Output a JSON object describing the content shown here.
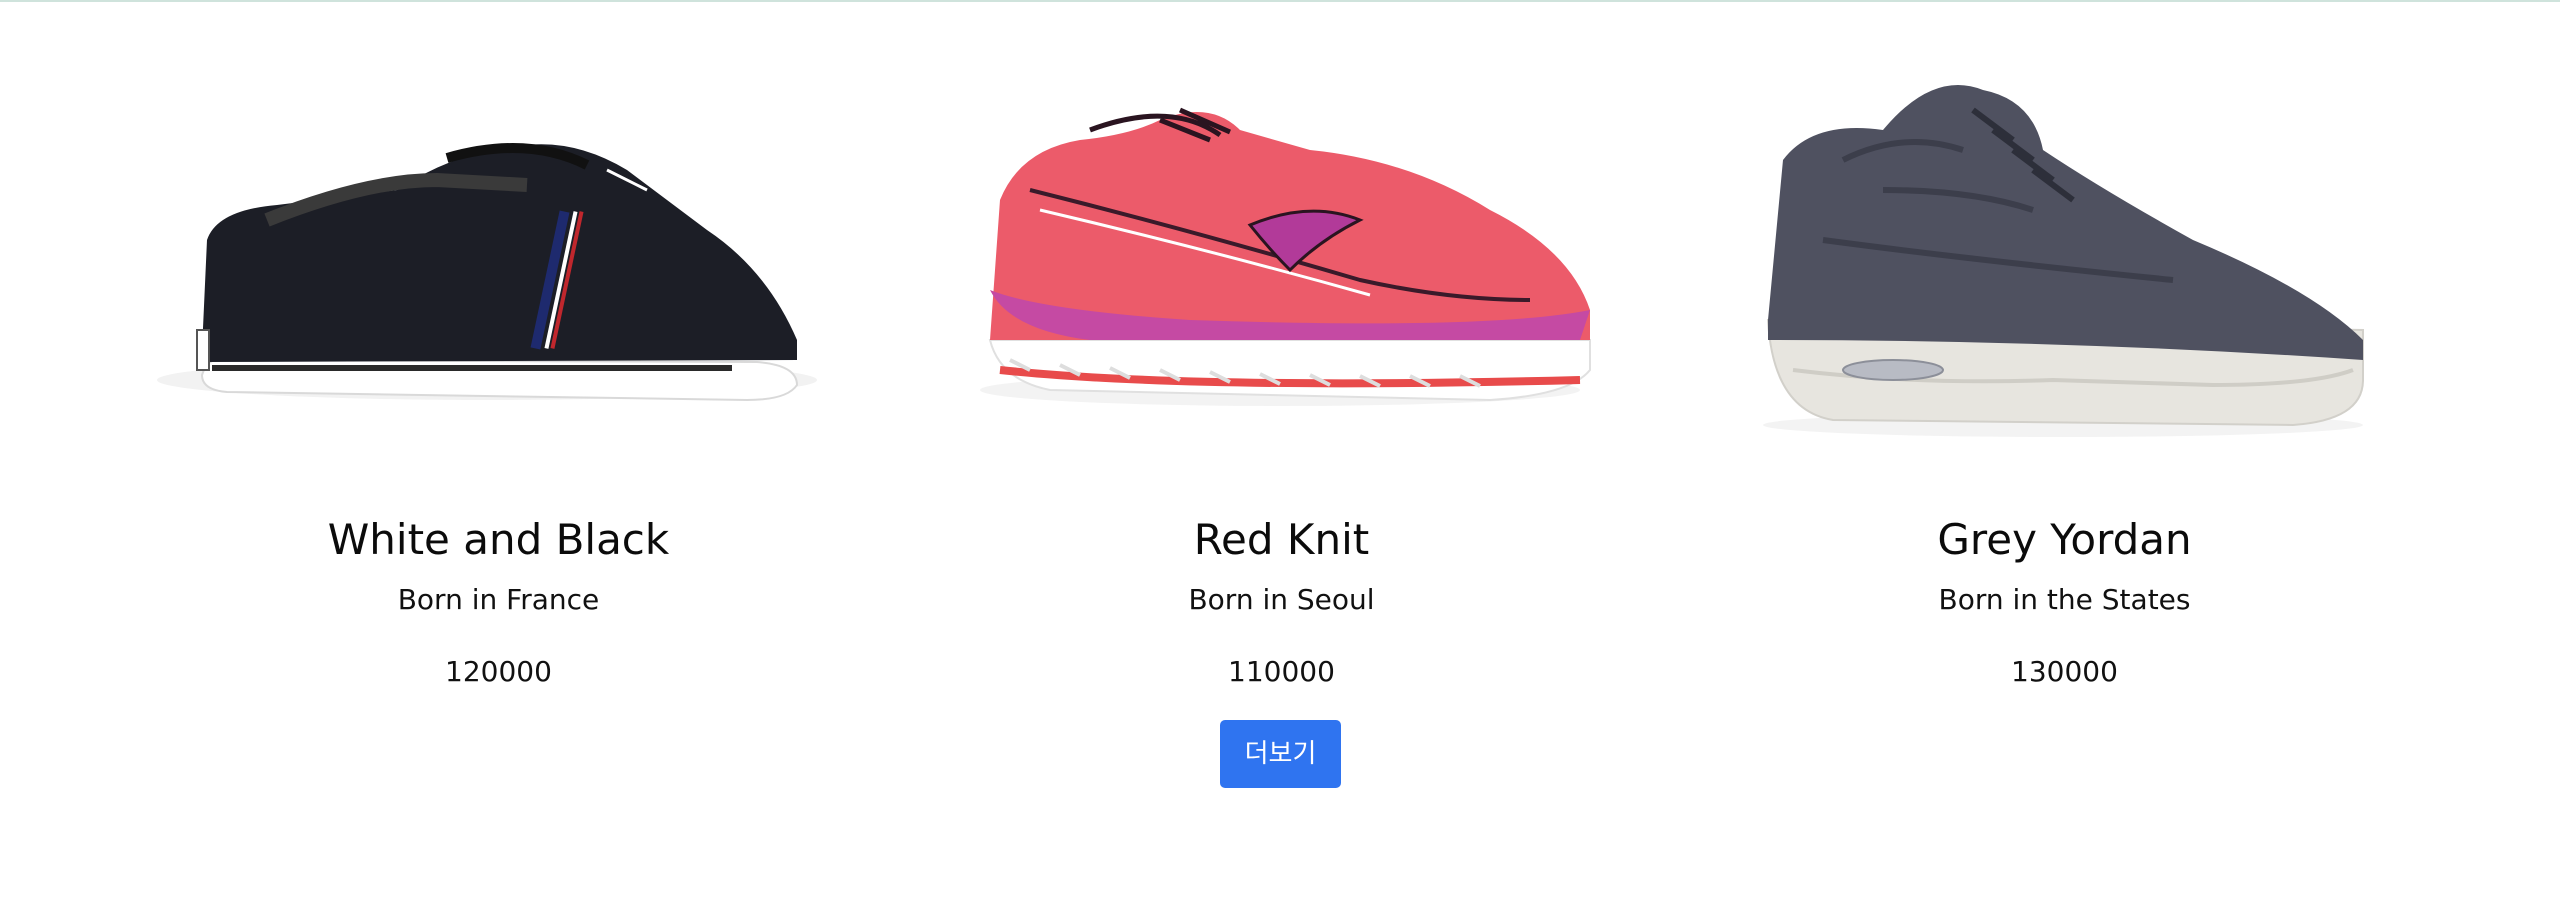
{
  "products": [
    {
      "name": "White and Black",
      "origin": "Born in France",
      "price": "120000",
      "image_icon": "sneaker-black-white-icon"
    },
    {
      "name": "Red Knit",
      "origin": "Born in Seoul",
      "price": "110000",
      "image_icon": "sneaker-red-knit-icon"
    },
    {
      "name": "Grey Yordan",
      "origin": "Born in the States",
      "price": "130000",
      "image_icon": "sneaker-grey-icon"
    }
  ],
  "more_button": {
    "label": "더보기",
    "color": "#2f74f0"
  }
}
